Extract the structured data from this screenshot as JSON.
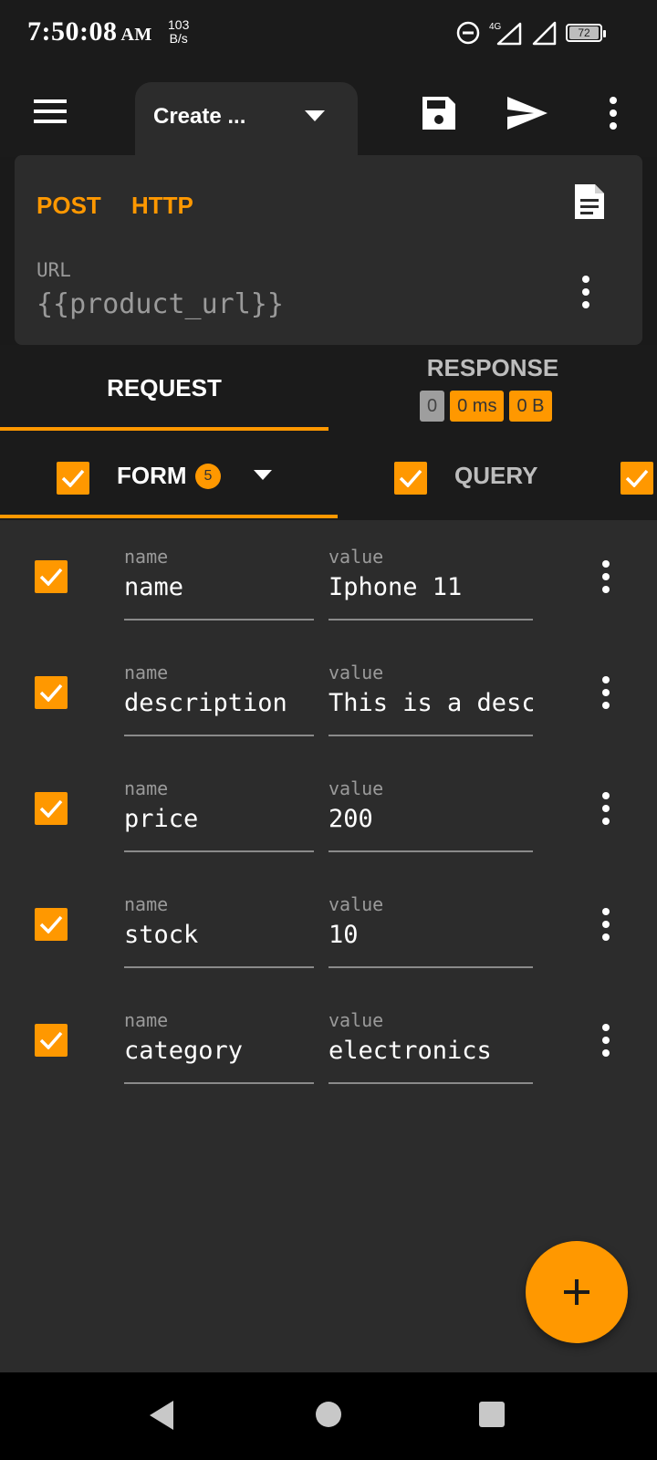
{
  "status_bar": {
    "time": "7:50:08",
    "ampm": "AM",
    "net_speed_value": "103",
    "net_speed_unit": "B/s",
    "network_type": "4G",
    "battery": "72",
    "icons": [
      "dnd-icon",
      "signal-4g-icon",
      "signal-icon",
      "battery-icon"
    ]
  },
  "app_bar": {
    "request_tab_label": "Create ...",
    "icons": [
      "menu-icon",
      "chevron-down-icon",
      "save-icon",
      "send-icon",
      "more-vert-icon"
    ]
  },
  "request": {
    "method": "POST",
    "protocol": "HTTP",
    "url_label": "URL",
    "url_value": "{{product_url}}"
  },
  "main_tabs": {
    "request_label": "REQUEST",
    "response_label": "RESPONSE",
    "response_status": "0",
    "response_time": "0 ms",
    "response_size": "0 B"
  },
  "sub_tabs": {
    "form_label": "FORM",
    "form_count": "5",
    "query_label": "QUERY"
  },
  "form_fields": [
    {
      "name_label": "name",
      "name": "name",
      "value_label": "value",
      "value": "Iphone 11",
      "enabled": true
    },
    {
      "name_label": "name",
      "name": "description",
      "value_label": "value",
      "value": "This is a desc",
      "enabled": true
    },
    {
      "name_label": "name",
      "name": "price",
      "value_label": "value",
      "value": "200",
      "enabled": true
    },
    {
      "name_label": "name",
      "name": "stock",
      "value_label": "value",
      "value": "10",
      "enabled": true
    },
    {
      "name_label": "name",
      "name": "category",
      "value_label": "value",
      "value": "electronics",
      "enabled": true
    }
  ],
  "colors": {
    "accent": "#ff9800",
    "background": "#1b1b1b",
    "surface": "#2c2c2c",
    "muted_text": "#9a9a9a"
  }
}
